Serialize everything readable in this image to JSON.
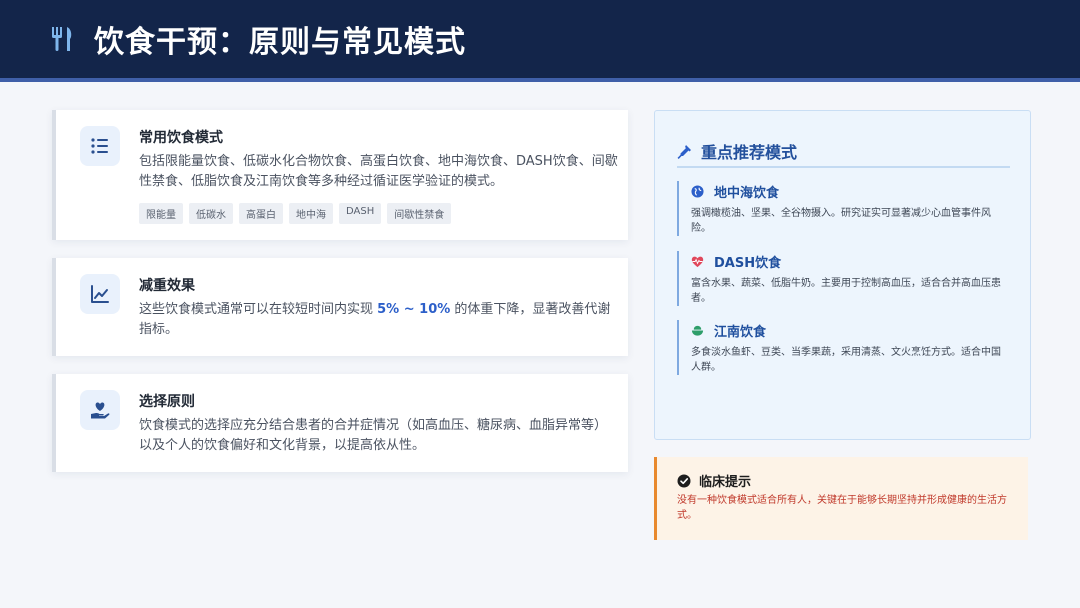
{
  "header": {
    "title": "饮食干预：原则与常见模式",
    "icon": "utensils-icon"
  },
  "cards": [
    {
      "title": "常用饮食模式",
      "icon": "list-icon",
      "desc": "包括限能量饮食、低碳水化合物饮食、高蛋白饮食、地中海饮食、DASH饮食、间歇性禁食、低脂饮食及江南饮食等多种经过循证医学验证的模式。",
      "tags": [
        "限能量",
        "低碳水",
        "高蛋白",
        "地中海",
        "DASH",
        "间歇性禁食"
      ]
    },
    {
      "title": "减重效果",
      "icon": "chart-line-icon",
      "desc_before": "这些饮食模式通常可以在较短时间内实现 ",
      "desc_highlight": "5% ~ 10%",
      "desc_after": " 的体重下降，显著改善代谢指标。"
    },
    {
      "title": "选择原则",
      "icon": "hand-heart-icon",
      "desc": "饮食模式的选择应充分结合患者的合并症情况（如高血压、糖尿病、血脂异常等）以及个人的饮食偏好和文化背景，以提高依从性。"
    }
  ],
  "recommended": {
    "title": "重点推荐模式",
    "icon": "syringe-icon",
    "items": [
      {
        "name": "地中海饮食",
        "icon": "globe-icon",
        "icon_color": "#2c5fc9",
        "text": "强调橄榄油、坚果、全谷物摄入。研究证实可显著减少心血管事件风险。"
      },
      {
        "name": "DASH饮食",
        "icon": "heart-pulse-icon",
        "icon_color": "#e0475b",
        "text": "富含水果、蔬菜、低脂牛奶。主要用于控制高血压，适合合并高血压患者。"
      },
      {
        "name": "江南饮食",
        "icon": "bowl-icon",
        "icon_color": "#2e9e6a",
        "text": "多食淡水鱼虾、豆类、当季果蔬，采用清蒸、文火烹饪方式。适合中国人群。"
      }
    ]
  },
  "tip": {
    "title": "临床提示",
    "icon": "check-circle-icon",
    "text": "没有一种饮食模式适合所有人，关键在于能够长期坚持并形成健康的生活方式。"
  }
}
